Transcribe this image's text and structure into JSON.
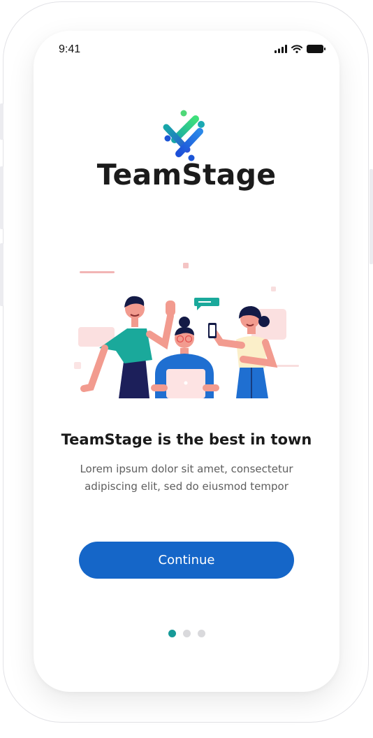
{
  "status_bar": {
    "time": "9:41",
    "icons": [
      "signal-icon",
      "wifi-icon",
      "battery-icon"
    ]
  },
  "brand": {
    "name": "TeamStage",
    "logo_icon": "teamstage-logo-icon"
  },
  "illustration": {
    "icon": "team-collaboration-illustration"
  },
  "onboarding": {
    "headline": "TeamStage is the best in town",
    "body_line_1": "Lorem ipsum dolor sit amet, consectetur",
    "body_line_2": "adipiscing elit, sed do eiusmod tempor"
  },
  "actions": {
    "continue_label": "Continue"
  },
  "pager": {
    "count": 3,
    "active_index": 0
  },
  "colors": {
    "primary": "#1566c8",
    "accent": "#169a98",
    "text": "#1a1a1a",
    "muted": "#5e5e5e"
  }
}
